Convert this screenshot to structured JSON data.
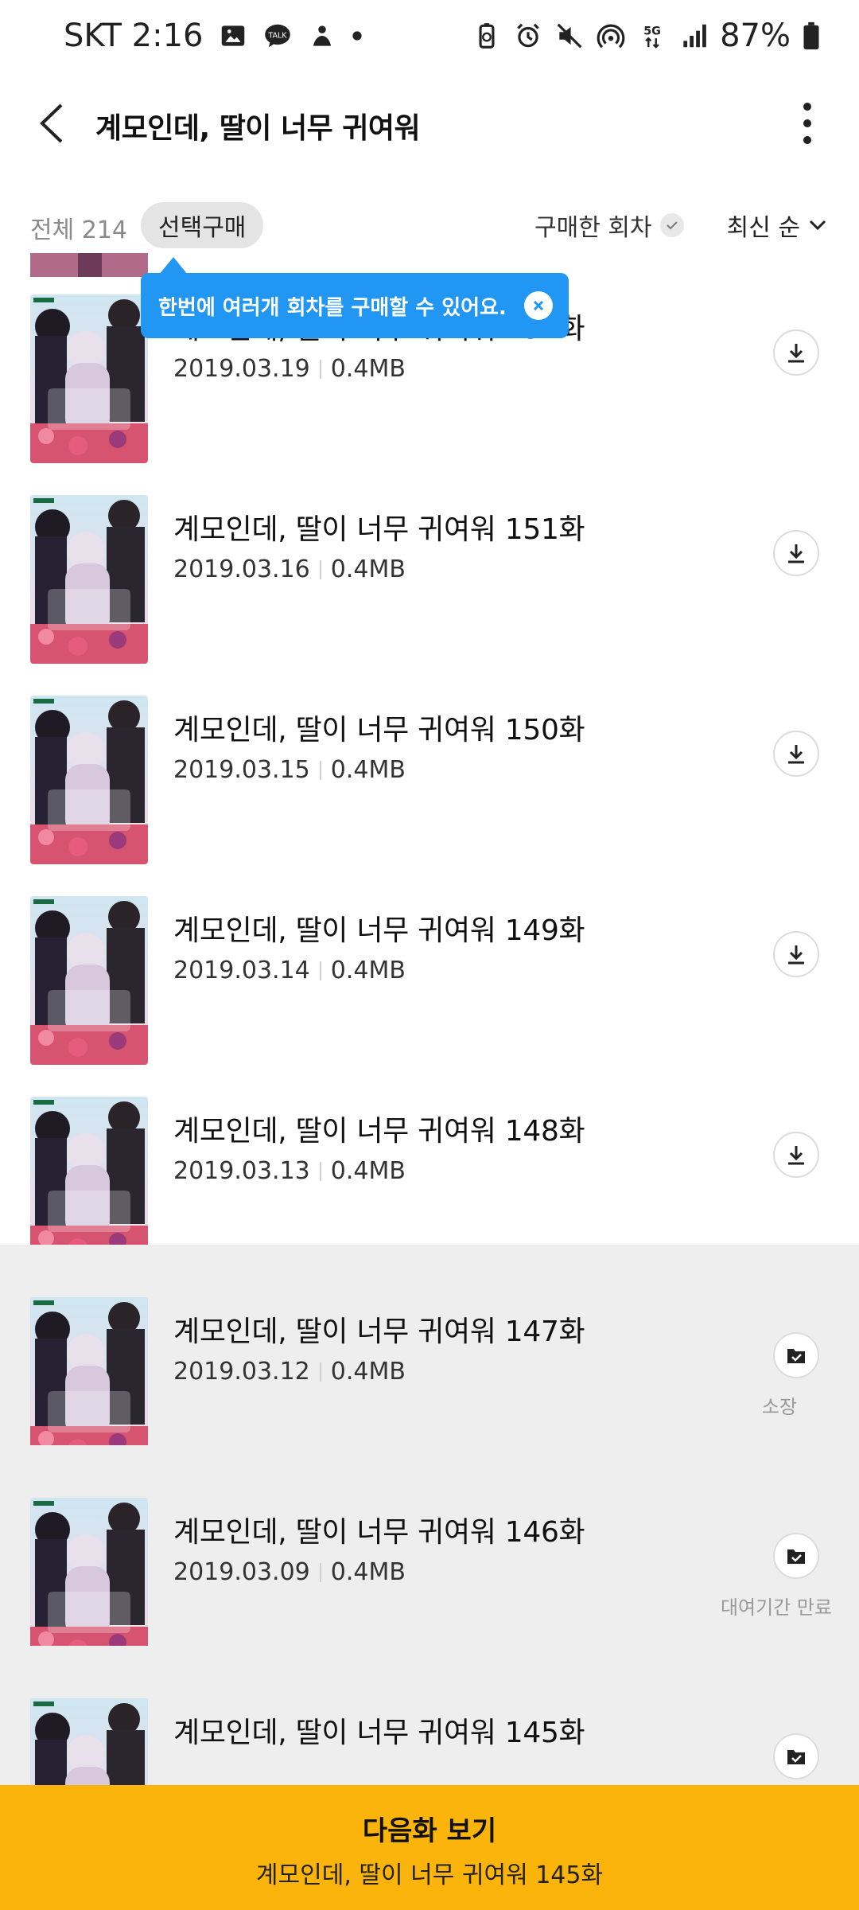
{
  "status_bar": {
    "carrier_time": "SKT 2:16",
    "battery": "87%"
  },
  "header": {
    "title": "계모인데, 딸이 너무 귀여워"
  },
  "filters": {
    "total": "전체 214",
    "select_purchase": "선택구매",
    "purchased": "구매한 회차",
    "sort": "최신 순"
  },
  "tooltip": {
    "text": "한번에 여러개 회차를 구매할 수 있어요."
  },
  "episodes": [
    {
      "title": "계모인데, 딸이 너무 귀여워 152화",
      "date": "2019.03.19",
      "size": "0.4MB",
      "action": "download"
    },
    {
      "title": "계모인데, 딸이 너무 귀여워 151화",
      "date": "2019.03.16",
      "size": "0.4MB",
      "action": "download"
    },
    {
      "title": "계모인데, 딸이 너무 귀여워 150화",
      "date": "2019.03.15",
      "size": "0.4MB",
      "action": "download"
    },
    {
      "title": "계모인데, 딸이 너무 귀여워 149화",
      "date": "2019.03.14",
      "size": "0.4MB",
      "action": "download"
    },
    {
      "title": "계모인데, 딸이 너무 귀여워 148화",
      "date": "2019.03.13",
      "size": "0.4MB",
      "action": "download"
    },
    {
      "title": "계모인데, 딸이 너무 귀여워 147화",
      "date": "2019.03.12",
      "size": "0.4MB",
      "action": "owned",
      "status": "소장"
    },
    {
      "title": "계모인데, 딸이 너무 귀여워 146화",
      "date": "2019.03.09",
      "size": "0.4MB",
      "action": "owned",
      "status": "대여기간 만료"
    },
    {
      "title": "계모인데, 딸이 너무 귀여워 145화",
      "date": "",
      "size": "",
      "action": "owned"
    }
  ],
  "bottom_bar": {
    "title": "다음화 보기",
    "subtitle": "계모인데, 딸이 너무 귀여워 145화"
  },
  "colors": {
    "accent_yellow": "#fbb40b",
    "tooltip_blue": "#2196f3",
    "owned_row_bg": "#eeeeee"
  },
  "icons": [
    "back-arrow-icon",
    "more-vertical-icon",
    "check-icon",
    "chevron-down-icon",
    "close-icon",
    "download-icon",
    "owned-check-icon"
  ]
}
